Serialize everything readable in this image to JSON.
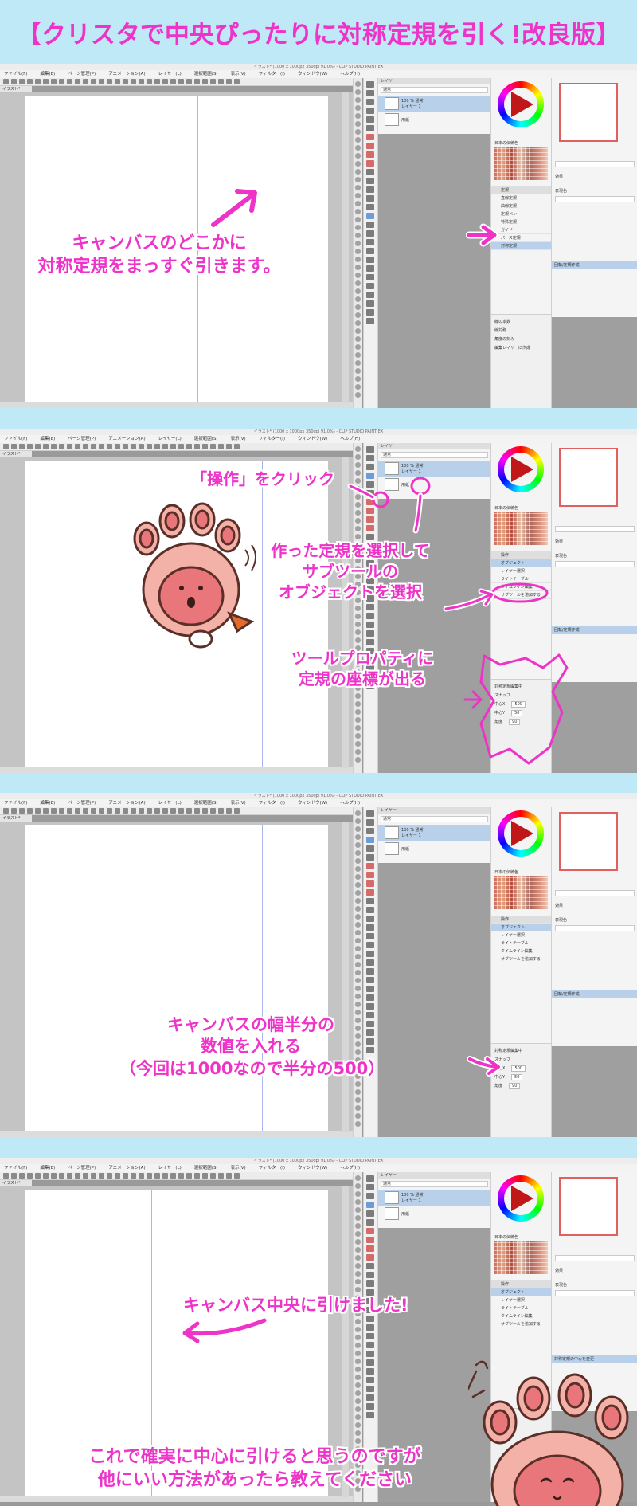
{
  "title": "【クリスタで中央ぴったりに対称定規を引く!改良版】",
  "app": {
    "window_title": "イラスト* (1000 x 1000px 350dpi 91.0%) - CLIP STUDIO PAINT EX",
    "menu": [
      "ファイル(F)",
      "編集(E)",
      "ページ管理(P)",
      "アニメーション(A)",
      "レイヤー(L)",
      "選択範囲(S)",
      "表示(V)",
      "フィルター(I)",
      "ウィンドウ(W)",
      "ヘルプ(H)"
    ],
    "doc_tab": "イラスト*",
    "layer_header": "レイヤー",
    "blend_mode": "通常",
    "layers": [
      {
        "name": "100 % 通常",
        "sub": "レイヤー 1"
      },
      {
        "name": "用紙",
        "sub": ""
      }
    ],
    "color_header": "カラーサークル",
    "swatch_header": "日本の伝統色",
    "subtool_header_ruler": "定規",
    "subtool_items_ruler": [
      "直線定規",
      "曲線定規",
      "定規ペン",
      "特殊定規",
      "ガイド",
      "パース定規",
      "対称定規"
    ],
    "subtool_header_operate": "操作",
    "subtool_items_operate": [
      "オブジェクト",
      "レイヤー選択",
      "ライトテーブル",
      "タイムライン編集",
      "サブツールを追加する"
    ],
    "property_items": [
      "線の本数",
      "線対称",
      "角度の刻み",
      "編集レイヤーに作成"
    ],
    "property_items_object": [
      "対称定規編集中",
      "スナップ",
      "中心X",
      "中心Y",
      "角度"
    ],
    "property_values": [
      "500",
      "50",
      "90"
    ],
    "right_labels": [
      "効果",
      "表現色",
      "カラー"
    ],
    "info_bar": "対称定規の中心を変更",
    "info_bar_2": "回転/定規作成"
  },
  "captions": {
    "p1": [
      "キャンバスのどこかに",
      "対称定規をまっすぐ引きます。"
    ],
    "p2_click": "「操作」をクリック",
    "p2_select": [
      "作った定規を選択して",
      "サブツールの",
      "オブジェクトを選択"
    ],
    "p2_prop": [
      "ツールプロパティに",
      "定規の座標が出る"
    ],
    "p3": [
      "キャンバスの幅半分の",
      "数値を入れる",
      "（今回は1000なので半分の500）"
    ],
    "p4_done": "キャンバス中央に引けました!",
    "p4_note": [
      "これで確実に中心に引けると思うのですが",
      "他にいい方法があったら教えてください"
    ]
  },
  "colors": {
    "accent": "#ee33c8",
    "background": "#bfe9f6",
    "selection": "#b9d0ea"
  }
}
